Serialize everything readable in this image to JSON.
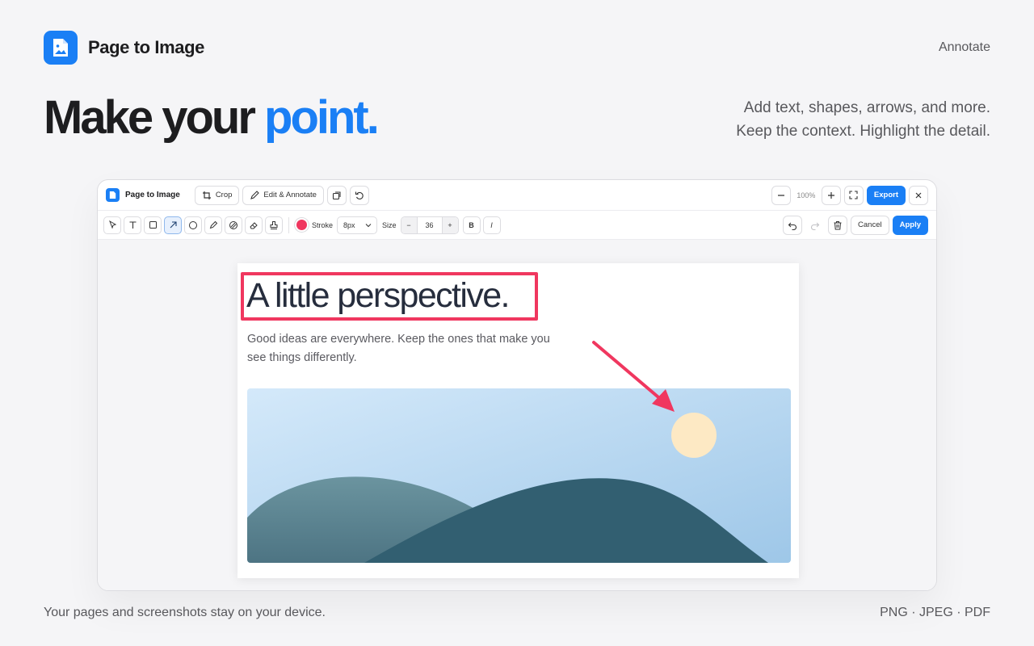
{
  "brand": {
    "name": "Page to Image"
  },
  "nav": {
    "link": "Annotate"
  },
  "hero": {
    "headline_pre": "Make your",
    "headline_accent": "point.",
    "tagline_line1": "Add text, shapes, arrows, and more.",
    "tagline_line2": "Keep the context. Highlight the detail."
  },
  "app": {
    "name": "Page to Image",
    "crop_label": "Crop",
    "edit_label": "Edit & Annotate",
    "zoom": "100%",
    "export_label": "Export",
    "toolbar": {
      "stroke_label": "Stroke",
      "stroke_value": "8px",
      "size_label": "Size",
      "size_minus": "−",
      "size_value": "36",
      "size_plus": "+",
      "bold": "B",
      "italic": "I",
      "cancel_label": "Cancel",
      "apply_label": "Apply",
      "stroke_color": "#f0375f"
    },
    "document": {
      "title": "A little perspective.",
      "body": "Good ideas are everywhere. Keep the ones that make you see things differently."
    }
  },
  "footer": {
    "privacy": "Your pages and screenshots stay on your device.",
    "formats": "PNG · JPEG · PDF"
  },
  "colors": {
    "accent": "#1a7ff5",
    "annotation": "#f0375f"
  }
}
